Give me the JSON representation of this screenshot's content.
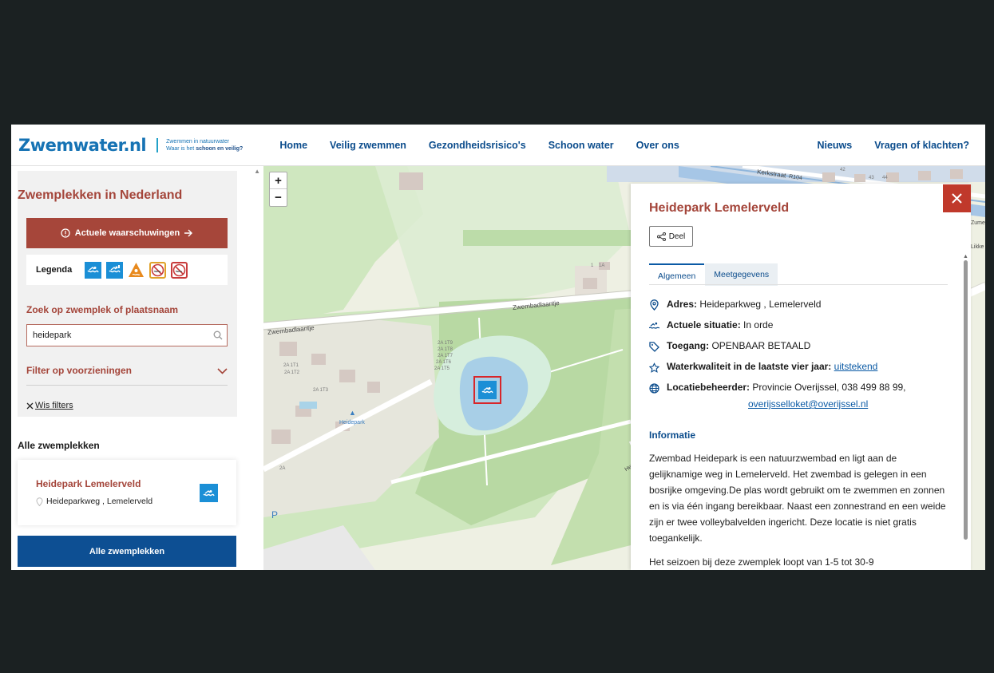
{
  "header": {
    "logo": "Zwemwater.nl",
    "tagline_line1": "Zwemmen in natuurwater",
    "tagline_line2_a": "Waar is het ",
    "tagline_line2_b": "schoon en veilig?",
    "nav": [
      "Home",
      "Veilig zwemmen",
      "Gezondheidsrisico's",
      "Schoon water",
      "Over ons"
    ],
    "nav_right": [
      "Nieuws",
      "Vragen of klachten?"
    ]
  },
  "sidebar": {
    "title": "Zwemplekken in Nederland",
    "warning_button": "Actuele waarschuwingen",
    "legend_label": "Legenda",
    "legend_icons": [
      "swim-ok-icon",
      "swim-warning-icon",
      "warning-triangle-icon",
      "no-swim-advice-icon",
      "swim-ban-icon"
    ],
    "search_title": "Zoek op zwemplek of plaatsnaam",
    "search_value": "heidepark",
    "filter_title": "Filter op voorzieningen",
    "clear_filters": "Wis filters",
    "all_title": "Alle zwemplekken",
    "card": {
      "title": "Heidepark Lemelerveld",
      "address": "Heideparkweg , Lemelerveld"
    },
    "all_button": "Alle zwemplekken"
  },
  "map": {
    "zoom_in": "+",
    "zoom_out": "−",
    "labels": {
      "street1": "Zwembadlaantje",
      "street2": "Zwembadlaantje",
      "street3": "Kerkstraat",
      "road": "R104",
      "poi": "Heidepark",
      "parking": "P",
      "house_numbers": [
        "2A 1T9",
        "2A 1T8",
        "2A 1T7",
        "2A 1T6",
        "2A 1T5",
        "2A 1T1",
        "2A 1T2",
        "2A 1T3",
        "2A 1T1",
        "2A",
        "1",
        "1A",
        "42",
        "43",
        "44"
      ],
      "edge_right": [
        "Heide",
        "Zume",
        "Likke"
      ]
    }
  },
  "detail": {
    "title": "Heidepark Lemelerveld",
    "share": "Deel",
    "tabs": [
      "Algemeen",
      "Meetgegevens"
    ],
    "address_label": "Adres:",
    "address_value": "Heideparkweg , Lemelerveld",
    "status_label": "Actuele situatie:",
    "status_value": "In orde",
    "access_label": "Toegang:",
    "access_value": "OPENBAAR BETAALD",
    "quality_label": "Waterkwaliteit in de laatste vier jaar:",
    "quality_value": "uitstekend",
    "manager_label": "Locatiebeheerder:",
    "manager_value": "Provincie Overijssel, 038 499 88 99,",
    "manager_email": "overijsselloket@overijssel.nl",
    "info_title": "Informatie",
    "info_text": "Zwembad Heidepark is een natuurzwembad en ligt aan de gelijknamige weg in Lemelerveld. Het zwembad is gelegen in een bosrijke omgeving.De plas wordt gebruikt om te zwemmen en zonnen en is via één ingang bereikbaar. Naast een zonnestrand en een weide zijn er twee volleybalvelden ingericht. Deze locatie is niet gratis toegankelijk.",
    "season_text": "Het seizoen bij deze zwemplek loopt van 1-5 tot 30-9"
  },
  "colors": {
    "brand_blue": "#1673b4",
    "nav_blue": "#0b4c8c",
    "accent_red": "#a4453a",
    "close_red": "#c0392b",
    "swim_blue": "#1b8fd6",
    "primary_button": "#0d4f93"
  }
}
